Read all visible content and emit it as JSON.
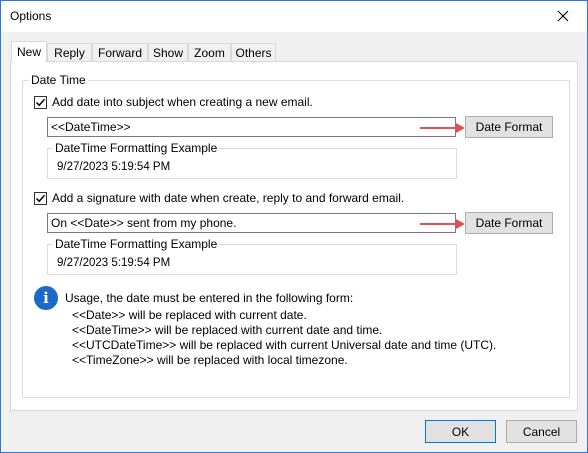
{
  "window": {
    "title": "Options"
  },
  "tabs": [
    {
      "label": "New",
      "active": true
    },
    {
      "label": "Reply"
    },
    {
      "label": "Forward"
    },
    {
      "label": "Show"
    },
    {
      "label": "Zoom"
    },
    {
      "label": "Others"
    }
  ],
  "datetime_group": {
    "label": "Date Time",
    "subject": {
      "checkbox_label": "Add date into subject when creating a new email.",
      "checked": true,
      "input_value": "<<DateTime>>",
      "format_button": "Date Format",
      "example_label": "DateTime Formatting Example",
      "example_value": "9/27/2023 5:19:54 PM"
    },
    "signature": {
      "checkbox_label": "Add a signature with date when create, reply to and forward email.",
      "checked": true,
      "input_value": "On <<Date>> sent from my phone.",
      "format_button": "Date Format",
      "example_label": "DateTime Formatting Example",
      "example_value": "9/27/2023 5:19:54 PM"
    },
    "usage": {
      "intro": "Usage, the date must be entered in the following form:",
      "lines": [
        "<<Date>> will be replaced with current date.",
        "<<DateTime>> will be replaced with current date and time.",
        "<<UTCDateTime>> will be replaced with current Universal date and time (UTC).",
        "<<TimeZone>> will be replaced with local timezone."
      ]
    }
  },
  "footer": {
    "ok": "OK",
    "cancel": "Cancel"
  },
  "colors": {
    "accent": "#0078d7",
    "arrow": "#e0524f",
    "info": "#1b69c9"
  }
}
